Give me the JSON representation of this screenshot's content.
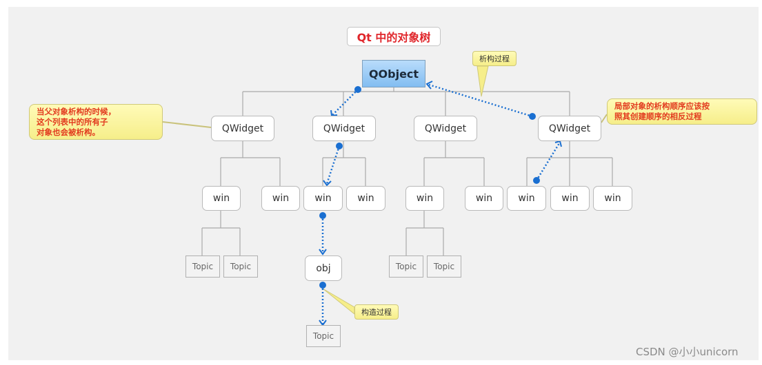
{
  "title": "Qt 中的对象树",
  "nodes": {
    "root": "QObject",
    "widgets": [
      "QWidget",
      "QWidget",
      "QWidget",
      "QWidget"
    ],
    "wins": [
      "win",
      "win",
      "win",
      "win",
      "win",
      "win",
      "win",
      "win",
      "win"
    ],
    "obj": "obj",
    "topics": [
      "Topic",
      "Topic",
      "Topic",
      "Topic",
      "Topic"
    ]
  },
  "callouts": {
    "destruct_label": "析构过程",
    "construct_label": "构造过程",
    "left_note": "当父对象析构的时候，\n这个列表中的所有子\n对象也会被析构。",
    "right_note": "局部对象的析构顺序应该按\n照其创建顺序的相反过程"
  },
  "colors": {
    "arrow": "#1a6fd1",
    "title_text": "#e0262b",
    "note_text": "#e23b1f",
    "root_fill": "#9ccdf6"
  },
  "watermark": "CSDN @小小unicorn"
}
